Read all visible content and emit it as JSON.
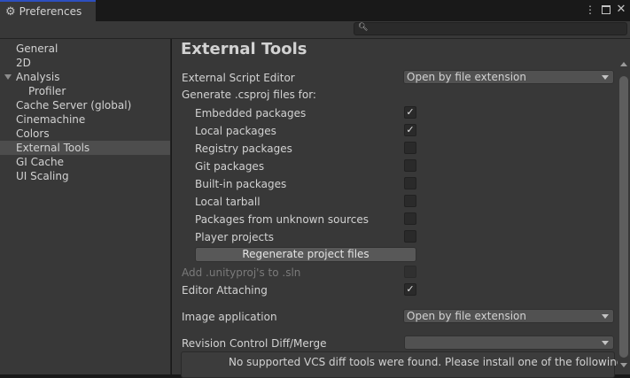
{
  "window": {
    "tab_title": "Preferences"
  },
  "sidebar": {
    "items": [
      {
        "label": "General"
      },
      {
        "label": "2D"
      },
      {
        "label": "Analysis"
      },
      {
        "label": "Profiler"
      },
      {
        "label": "Cache Server (global)"
      },
      {
        "label": "Cinemachine"
      },
      {
        "label": "Colors"
      },
      {
        "label": "External Tools",
        "selected": true
      },
      {
        "label": "GI Cache"
      },
      {
        "label": "UI Scaling"
      }
    ]
  },
  "content": {
    "heading": "External Tools",
    "external_script_editor": {
      "label": "External Script Editor",
      "value": "Open by file extension"
    },
    "generate_label": "Generate .csproj files for:",
    "packages": [
      {
        "label": "Embedded packages",
        "checked": true
      },
      {
        "label": "Local packages",
        "checked": true
      },
      {
        "label": "Registry packages",
        "checked": false
      },
      {
        "label": "Git packages",
        "checked": false
      },
      {
        "label": "Built-in packages",
        "checked": false
      },
      {
        "label": "Local tarball",
        "checked": false
      },
      {
        "label": "Packages from unknown sources",
        "checked": false
      },
      {
        "label": "Player projects",
        "checked": false
      }
    ],
    "regenerate_button": "Regenerate project files",
    "add_unityproj": {
      "label": "Add .unityproj's to .sln",
      "checked": false,
      "disabled": true
    },
    "editor_attaching": {
      "label": "Editor Attaching",
      "checked": true
    },
    "image_application": {
      "label": "Image application",
      "value": "Open by file extension"
    },
    "revision_control": {
      "label": "Revision Control Diff/Merge",
      "value": ""
    },
    "vcs_help": "No supported VCS diff tools were found. Please install one of the following"
  },
  "icons": {
    "tab": "gear-icon",
    "search": "search-icon"
  }
}
